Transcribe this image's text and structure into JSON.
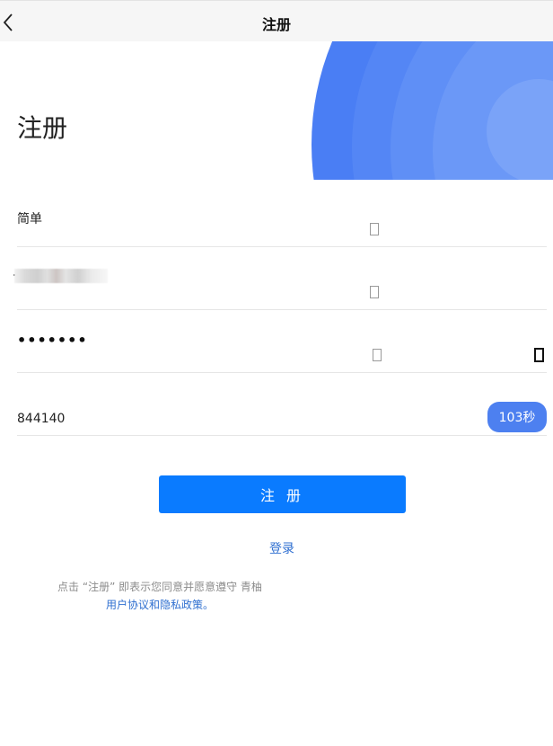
{
  "navbar": {
    "title": "注册",
    "back_icon": "chevron-left-icon"
  },
  "page": {
    "title": "注册"
  },
  "colors": {
    "accent": "#4d80f0",
    "primary_button": "#0a7bff",
    "link": "#2f6fd0",
    "hero_blue": "#4a7ef4"
  },
  "form": {
    "username": {
      "value": "简单",
      "clear_icon": "clear-icon"
    },
    "phone": {
      "value": "",
      "clear_icon": "clear-icon"
    },
    "password": {
      "value": "•••••••",
      "clear_icon": "clear-icon",
      "toggle_icon": "eye-icon"
    },
    "code": {
      "value": "844140",
      "countdown_label": "103秒"
    }
  },
  "actions": {
    "register_label": "注 册",
    "login_label": "登录"
  },
  "agreement": {
    "line1": "点击 “注册” 即表示您同意并愿意遵守 青柚",
    "link1": "用户协议",
    "and": "和",
    "link2": "隐私政策",
    "end": "。"
  }
}
